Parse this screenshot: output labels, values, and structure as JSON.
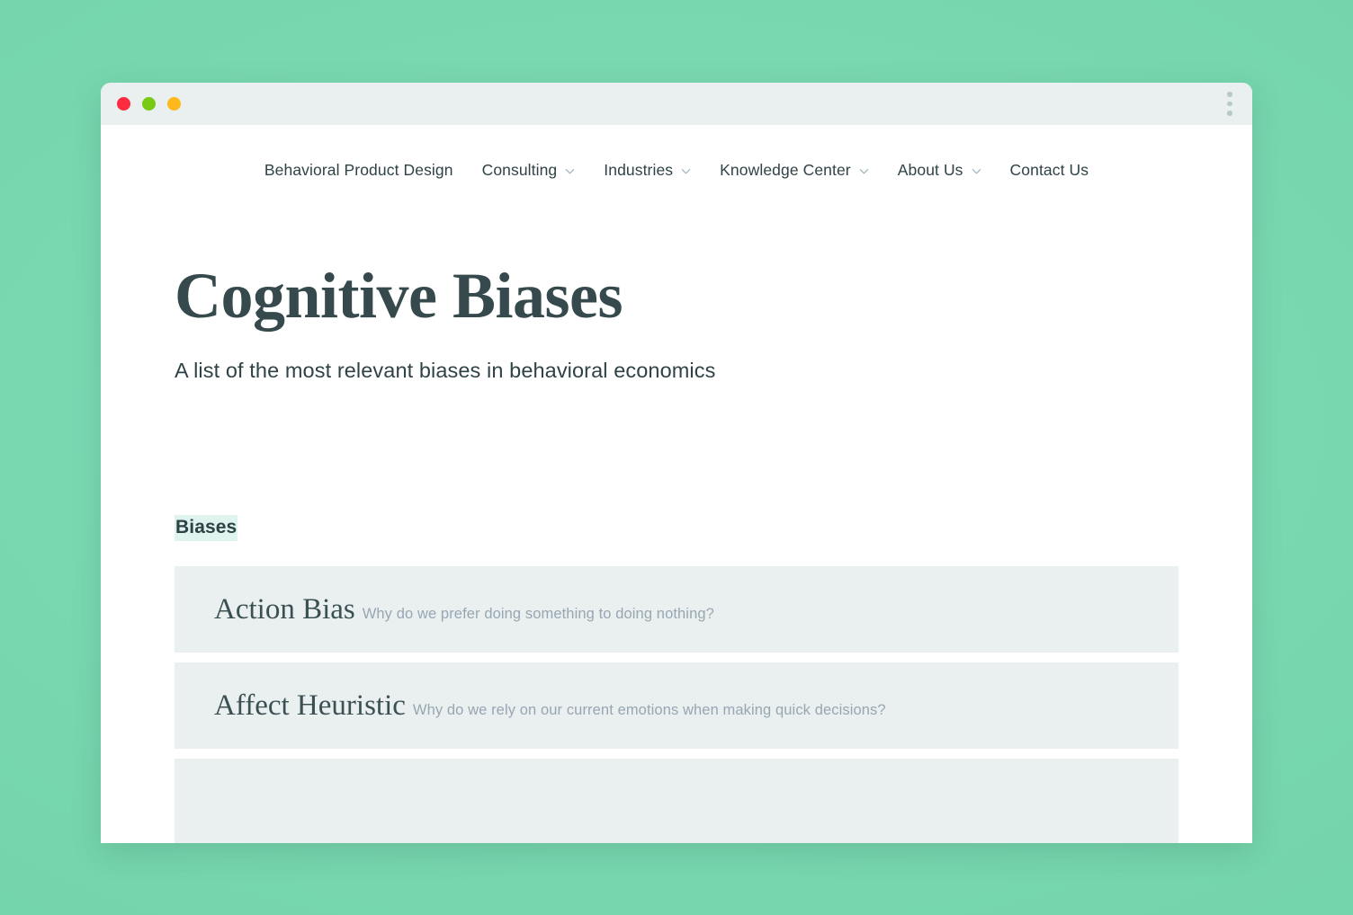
{
  "desktop": {
    "background_color": "#79d7ad"
  },
  "window": {
    "traffic_lights": [
      {
        "name": "close",
        "color": "#fc2b3f"
      },
      {
        "name": "minimize",
        "color": "#79ca14"
      },
      {
        "name": "maximize",
        "color": "#ffb81c"
      }
    ],
    "menu_icon": "kebab-menu-icon",
    "titlebar_color": "#eaeff0"
  },
  "nav": {
    "items": [
      {
        "label": "Behavioral Product Design",
        "has_dropdown": false
      },
      {
        "label": "Consulting",
        "has_dropdown": true
      },
      {
        "label": "Industries",
        "has_dropdown": true
      },
      {
        "label": "Knowledge Center",
        "has_dropdown": true
      },
      {
        "label": "About Us",
        "has_dropdown": true
      },
      {
        "label": "Contact Us",
        "has_dropdown": false
      }
    ]
  },
  "hero": {
    "title": "Cognitive Biases",
    "subtitle": "A list of the most relevant biases in behavioral economics",
    "title_color": "#36494c"
  },
  "section": {
    "heading": "Biases",
    "heading_highlight_color": "#e0f4ef",
    "items": [
      {
        "name": "Action Bias",
        "description": "Why do we prefer doing something to doing nothing?"
      },
      {
        "name": "Affect Heuristic",
        "description": "Why do we rely on our current emotions when making quick decisions?"
      },
      {
        "name": "",
        "description": ""
      }
    ]
  }
}
